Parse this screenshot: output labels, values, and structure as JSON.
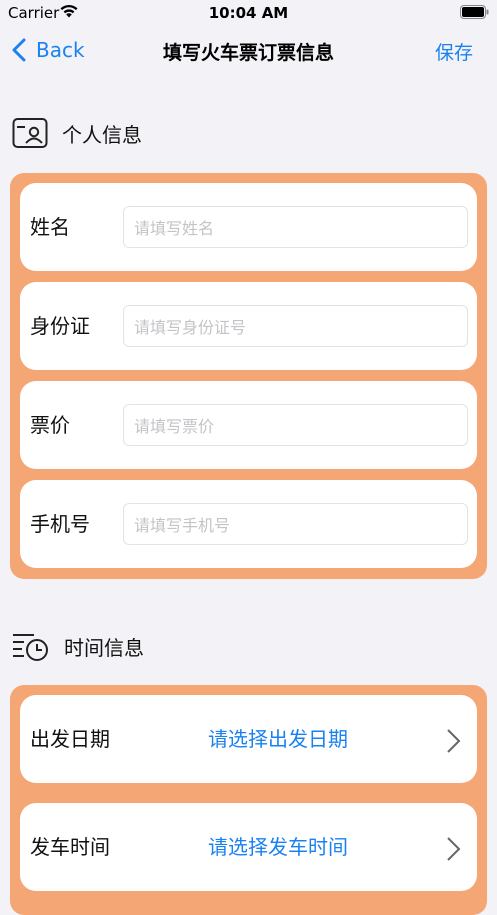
{
  "status": {
    "carrier": "Carrier",
    "time": "10:04 AM"
  },
  "nav": {
    "back_label": "Back",
    "title": "填写火车票订票信息",
    "save_label": "保存"
  },
  "personal": {
    "header": "个人信息",
    "fields": [
      {
        "label": "姓名",
        "placeholder": "请填写姓名"
      },
      {
        "label": "身份证",
        "placeholder": "请填写身份证号"
      },
      {
        "label": "票价",
        "placeholder": "请填写票价"
      },
      {
        "label": "手机号",
        "placeholder": "请填写手机号"
      }
    ]
  },
  "time_info": {
    "header": "时间信息",
    "rows": [
      {
        "label": "出发日期",
        "value": "请选择出发日期"
      },
      {
        "label": "发车时间",
        "value": "请选择发车时间"
      }
    ]
  },
  "colors": {
    "accent": "#1a82f0",
    "card_border": "#f4a674",
    "background": "#f2f2f7"
  },
  "icons": {
    "personal": "id-card-icon",
    "time": "clock-list-icon",
    "chevron": "chevron-right-icon",
    "back": "chevron-left-icon"
  }
}
